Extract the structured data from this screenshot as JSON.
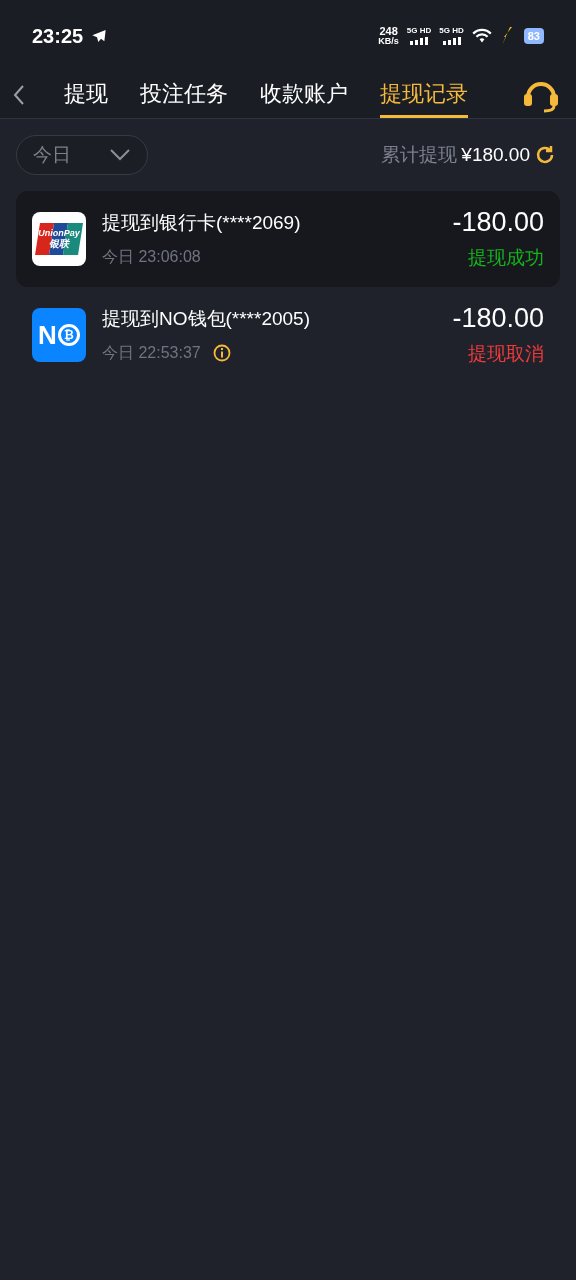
{
  "status_bar": {
    "time": "23:25",
    "speed_value": "248",
    "speed_unit": "KB/s",
    "networks": [
      "5G HD",
      "5G HD"
    ],
    "battery": "83"
  },
  "tabs": [
    {
      "label": "提现",
      "selected": false
    },
    {
      "label": "投注任务",
      "selected": false
    },
    {
      "label": "收款账户",
      "selected": false
    },
    {
      "label": "提现记录",
      "selected": true
    }
  ],
  "filter": {
    "value": "今日"
  },
  "summary": {
    "label": "累计提现",
    "amount": "¥180.00"
  },
  "records": [
    {
      "kind": "unionpay",
      "logo_lines": [
        "UnionPay",
        "银联"
      ],
      "title": "提现到银行卡(****2069)",
      "time": "今日 23:06:08",
      "info": false,
      "amount": "-180.00",
      "status": "提现成功",
      "color": "#16b21c",
      "selected": true
    },
    {
      "kind": "wallet",
      "logo_lines": [
        "N",
        "₿"
      ],
      "title": "提现到NO钱包(****2005)",
      "time": "今日 22:53:37",
      "info": true,
      "amount": "-180.00",
      "status": "提现取消",
      "color": "#ef3a3a",
      "selected": false
    }
  ]
}
